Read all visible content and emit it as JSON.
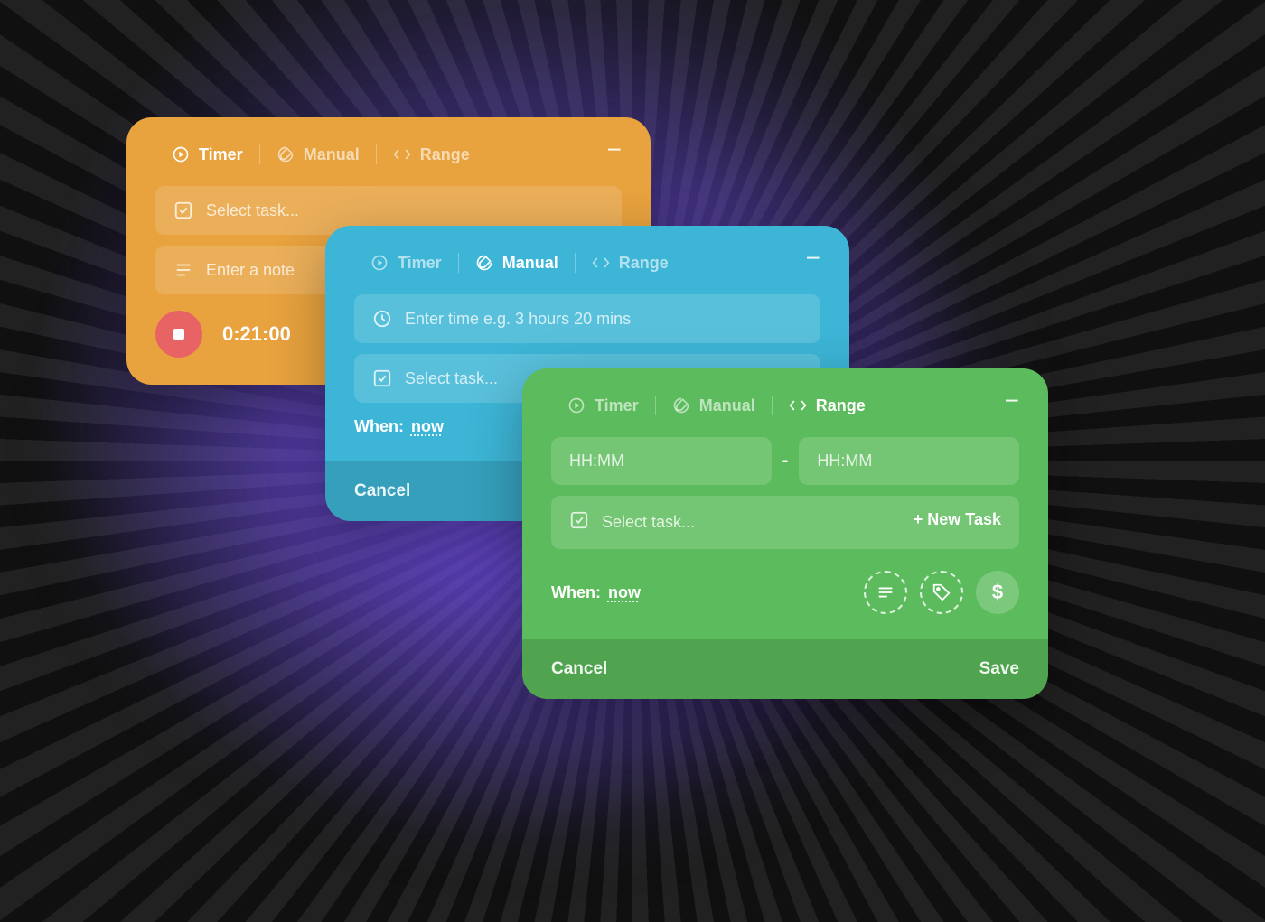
{
  "tabs": {
    "timer": "Timer",
    "manual": "Manual",
    "range": "Range"
  },
  "orange": {
    "select_task_placeholder": "Select task...",
    "note_placeholder": "Enter a note",
    "timer_value": "0:21:00"
  },
  "blue": {
    "time_placeholder": "Enter time e.g. 3 hours 20 mins",
    "select_task_placeholder": "Select task...",
    "when_label": "When:",
    "when_value": "now",
    "cancel": "Cancel"
  },
  "green": {
    "hhmm_placeholder": "HH:MM",
    "dash": "-",
    "select_task_placeholder": "Select task...",
    "new_task": "+ New Task",
    "when_label": "When:",
    "when_value": "now",
    "dollar": "$",
    "cancel": "Cancel",
    "save": "Save"
  }
}
